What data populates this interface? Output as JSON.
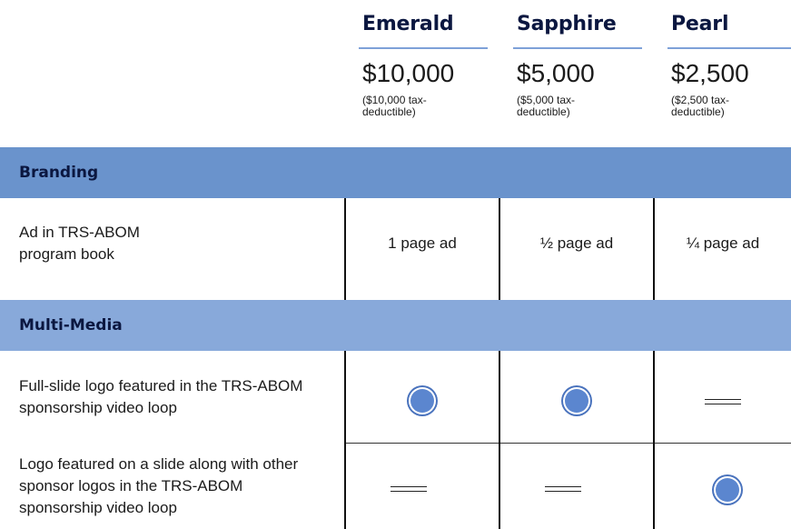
{
  "tiers": [
    {
      "name": "Emerald",
      "price": "$10,000",
      "note": "($10,000 tax-deductible)"
    },
    {
      "name": "Sapphire",
      "price": "$5,000",
      "note": "($5,000 tax-deductible)"
    },
    {
      "name": "Pearl",
      "price": "$2,500",
      "note": "($2,500 tax-deductible)"
    }
  ],
  "sections": [
    {
      "title": "Branding",
      "rows": [
        {
          "label": "Ad in TRS-ABOM program book",
          "values": [
            "1 page ad",
            "½ page ad",
            "¼ page ad"
          ]
        }
      ]
    },
    {
      "title": "Multi-Media",
      "rows": [
        {
          "label": "Full-slide logo featured in the TRS-ABOM sponsorship video loop",
          "values": [
            "included-icon",
            "included-icon",
            "not-included-icon"
          ]
        },
        {
          "label": "Logo featured on a slide along with other sponsor logos in the TRS-ABOM sponsorship video loop",
          "values": [
            "not-included-icon",
            "not-included-icon",
            "included-icon"
          ]
        }
      ]
    }
  ],
  "colors": {
    "branding_bar": "#6a93cc",
    "multimedia_bar": "#88a9da",
    "tier_name": "#0b1740",
    "included_dot": "#5b86cf"
  }
}
